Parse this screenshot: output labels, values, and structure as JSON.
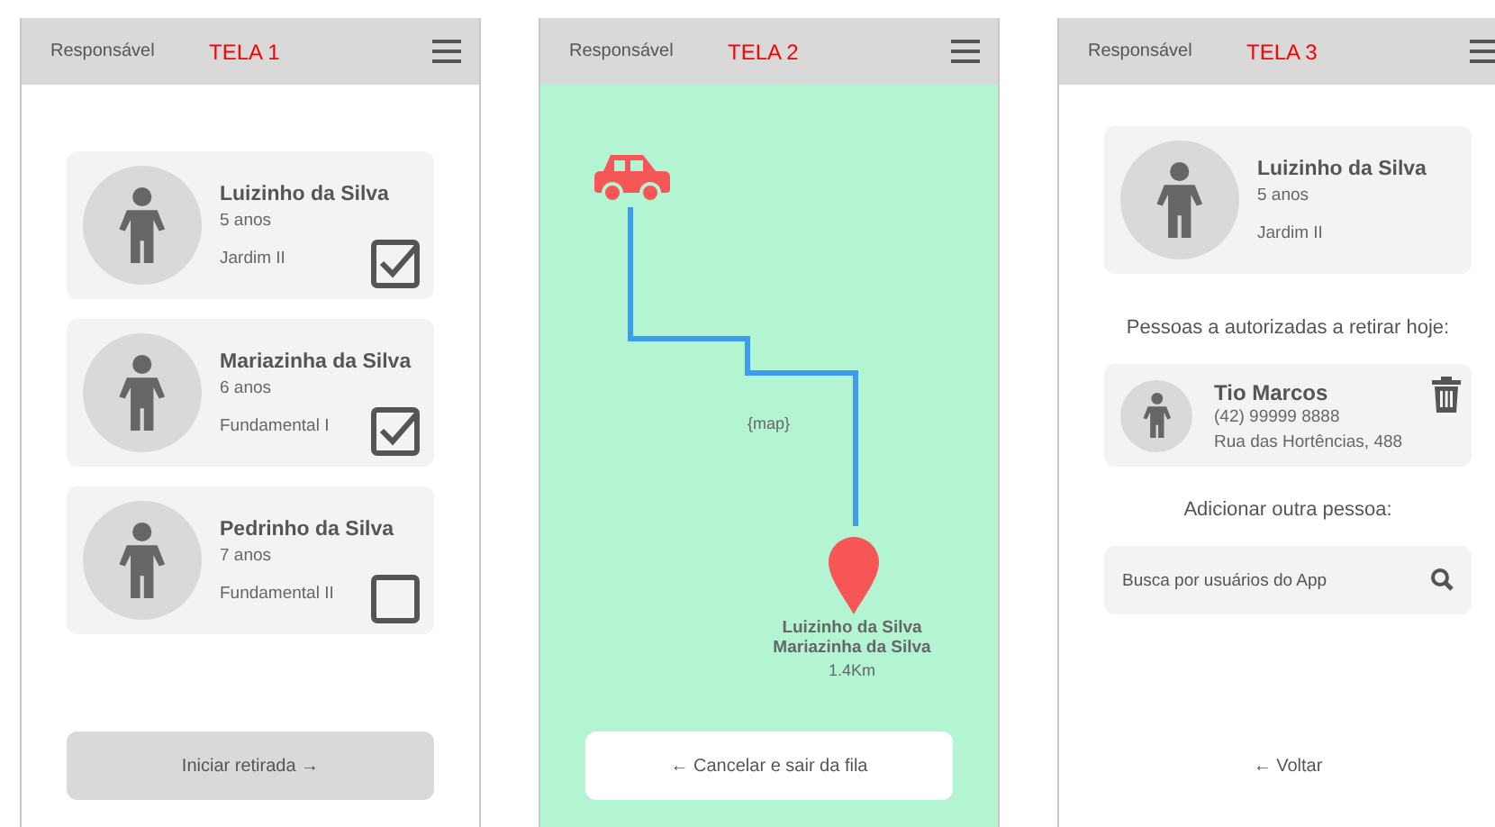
{
  "screens": [
    {
      "kind": "list",
      "header": {
        "role": "Responsável",
        "title": "TELA 1"
      },
      "children": [
        {
          "name": "Luizinho da Silva",
          "age": "5 anos",
          "grade": "Jardim II",
          "checked": true
        },
        {
          "name": "Mariazinha da Silva",
          "age": "6 anos",
          "grade": "Fundamental I",
          "checked": true
        },
        {
          "name": "Pedrinho da Silva",
          "age": "7 anos",
          "grade": "Fundamental II",
          "checked": false
        }
      ],
      "button": "Iniciar retirada →"
    },
    {
      "kind": "map",
      "header": {
        "role": "Responsável",
        "title": "TELA 2"
      },
      "map_label": "{map}",
      "destination": {
        "names": [
          "Luizinho da Silva",
          "Mariazinha da Silva"
        ],
        "distance": "1.4Km"
      },
      "button": "← Cancelar e sair da fila"
    },
    {
      "kind": "details",
      "header": {
        "role": "Responsável",
        "title": "TELA 3"
      },
      "child": {
        "name": "Luizinho da Silva",
        "age": "5 anos",
        "grade": "Jardim II"
      },
      "authorized_heading": "Pessoas a autorizadas a retirar hoje:",
      "authorized": [
        {
          "name": "Tio Marcos",
          "phone": "(42) 99999 8888",
          "address": "Rua das Hortências, 488"
        }
      ],
      "add_heading": "Adicionar outra pessoa:",
      "search": {
        "placeholder": "Busca por usuários do App"
      },
      "back": "← Voltar"
    }
  ]
}
